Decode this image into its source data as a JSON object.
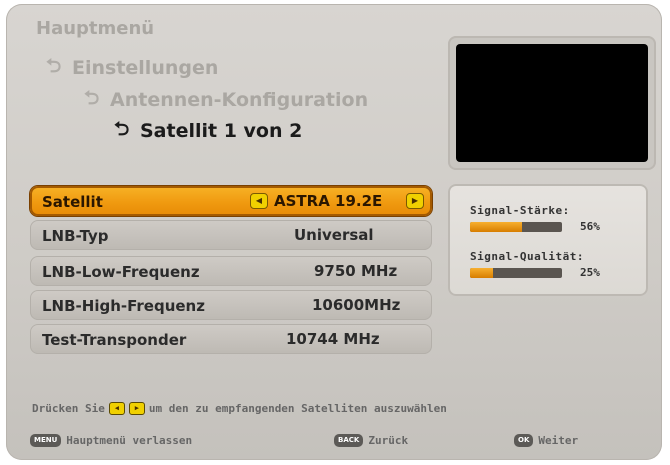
{
  "breadcrumbs": [
    {
      "label": "Hauptmenü",
      "icon": null
    },
    {
      "label": "Einstellungen",
      "icon": "return-arrow-icon"
    },
    {
      "label": "Antennen-Konfiguration",
      "icon": "return-arrow-icon"
    },
    {
      "label": "Satellit 1 von 2",
      "icon": "return-arrow-icon"
    }
  ],
  "settings": {
    "satellite": {
      "label": "Satellit",
      "value": "ASTRA 19.2E"
    },
    "lnb_type": {
      "label": "LNB-Typ",
      "value": "Universal"
    },
    "lnb_low": {
      "label": "LNB-Low-Frequenz",
      "value": "9750 MHz"
    },
    "lnb_high": {
      "label": "LNB-High-Frequenz",
      "value": "10600MHz"
    },
    "test_transponder": {
      "label": "Test-Transponder",
      "value": "10744 MHz"
    }
  },
  "signal": {
    "strength": {
      "label": "Signal-Stärke:",
      "percent": 56,
      "text": "56%"
    },
    "quality": {
      "label": "Signal-Qualität:",
      "percent": 25,
      "text": "25%"
    }
  },
  "footer": {
    "hint_prefix": "Drücken Sie",
    "hint_suffix": "um den zu empfangenden Satelliten auszuwählen",
    "menu_key": "MENU",
    "menu_label": "Hauptmenü verlassen",
    "back_key": "BACK",
    "back_label": "Zurück",
    "ok_key": "OK",
    "ok_label": "Weiter"
  },
  "colors": {
    "accent": "#f09a10",
    "bar_fill": "#e08800",
    "bar_bg": "#5a5550"
  }
}
